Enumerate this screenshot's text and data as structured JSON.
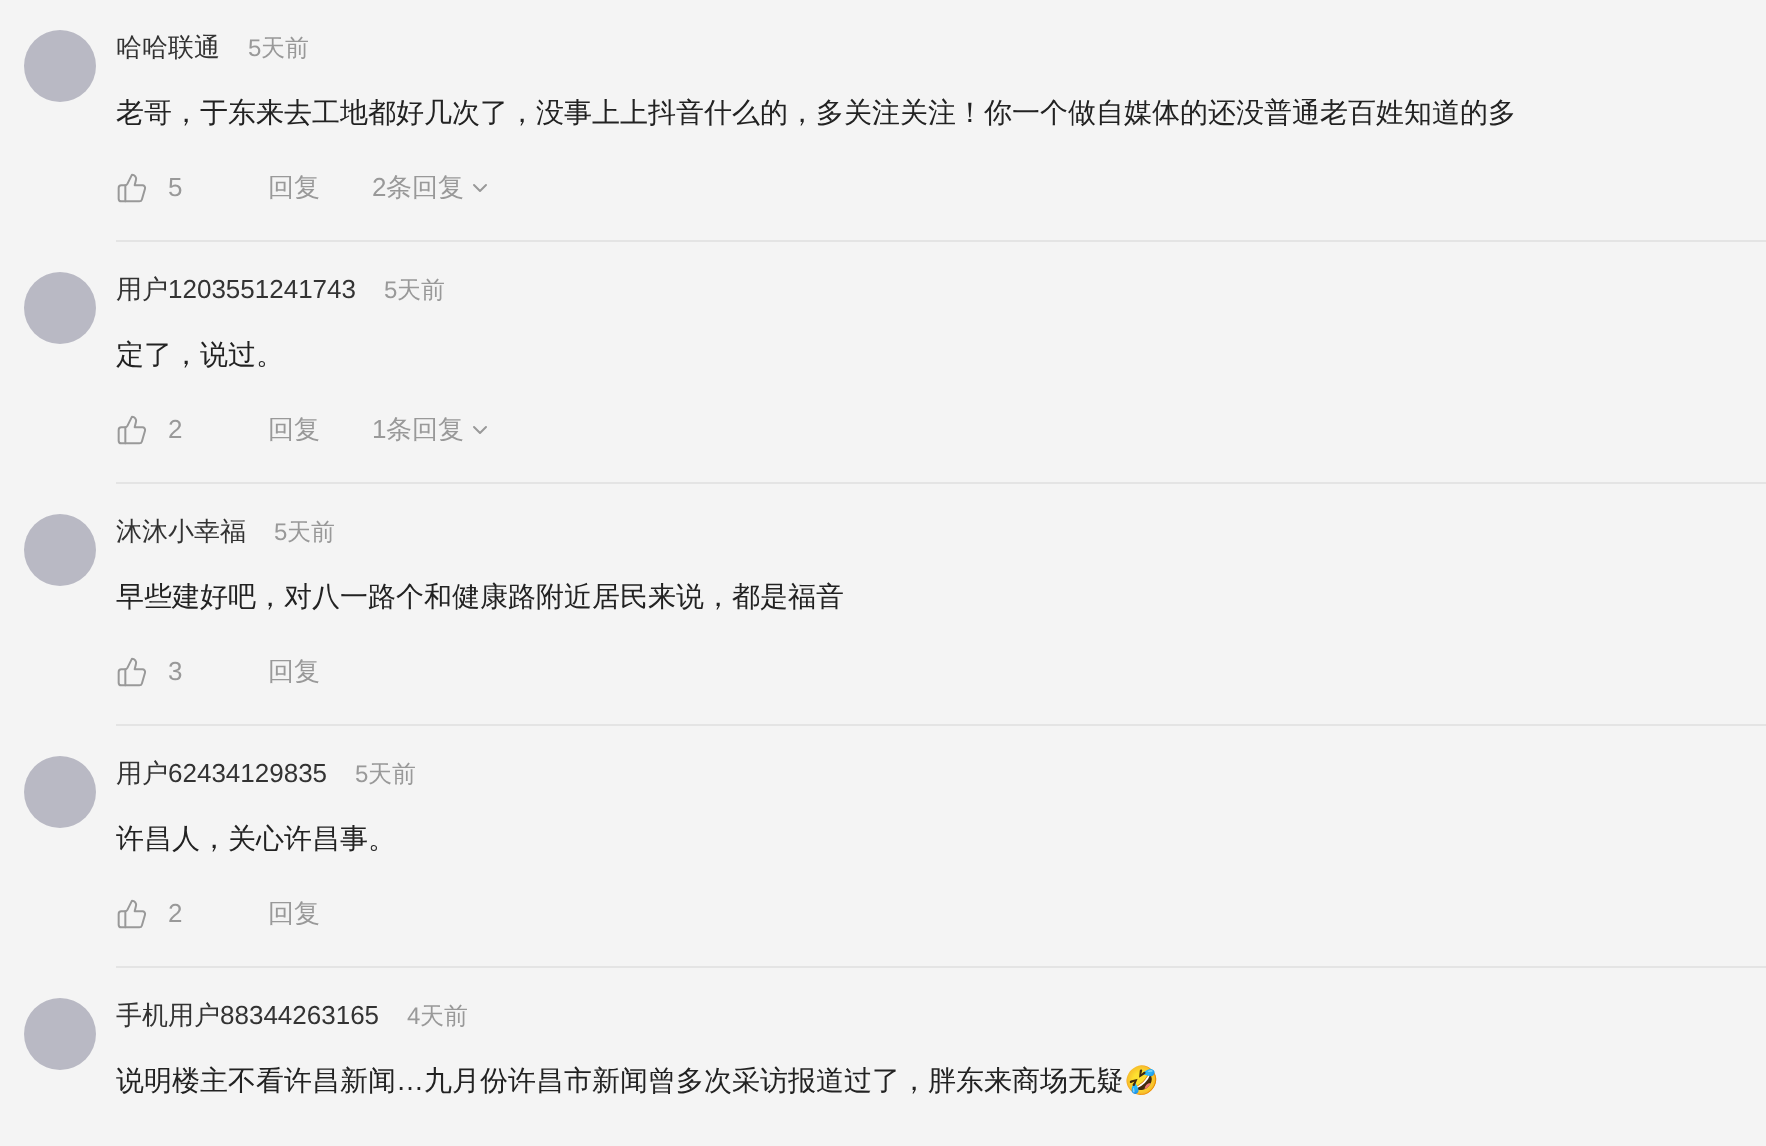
{
  "comments": [
    {
      "user": "哈哈联通",
      "time": "5天前",
      "text": "老哥，于东来去工地都好几次了，没事上上抖音什么的，多关注关注！你一个做自媒体的还没普通老百姓知道的多",
      "likes": "5",
      "reply": "回复",
      "replies": "2条回复"
    },
    {
      "user": "用户1203551241743",
      "time": "5天前",
      "text": "定了，说过。",
      "likes": "2",
      "reply": "回复",
      "replies": "1条回复"
    },
    {
      "user": "沐沐小幸福",
      "time": "5天前",
      "text": "早些建好吧，对八一路个和健康路附近居民来说，都是福音",
      "likes": "3",
      "reply": "回复"
    },
    {
      "user": "用户62434129835",
      "time": "5天前",
      "text": "许昌人，关心许昌事。",
      "likes": "2",
      "reply": "回复"
    },
    {
      "user": "手机用户88344263165",
      "time": "4天前",
      "text": "说明楼主不看许昌新闻…九月份许昌市新闻曾多次采访报道过了，胖东来商场无疑🤣"
    }
  ]
}
